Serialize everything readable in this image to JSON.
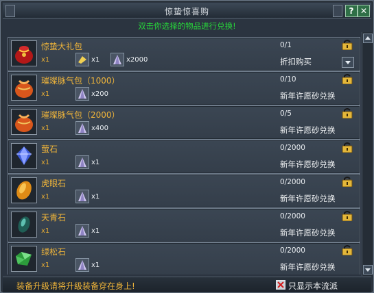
{
  "window": {
    "title": "惊蛰惊喜购",
    "help_label": "?",
    "close_label": "✕"
  },
  "instruction": "双击你选择的物品进行兑换!",
  "items": [
    {
      "name": "惊蛰大礼包",
      "qty": "x1",
      "costs": [
        {
          "icon": "gold-coin-icon",
          "amount": "x1"
        },
        {
          "icon": "crystal-sand-icon",
          "amount": "x2000"
        }
      ],
      "progress": "0/1",
      "exchange": "折扣购买",
      "icon": "red-gift-bag"
    },
    {
      "name": "璀璨脉气包（1000）",
      "qty": "x1",
      "costs": [
        {
          "icon": "crystal-sand-icon",
          "amount": "x200"
        }
      ],
      "progress": "0/10",
      "exchange": "新年许愿砂兑换",
      "icon": "orange-bag"
    },
    {
      "name": "璀璨脉气包（2000）",
      "qty": "x1",
      "costs": [
        {
          "icon": "crystal-sand-icon",
          "amount": "x400"
        }
      ],
      "progress": "0/5",
      "exchange": "新年许愿砂兑换",
      "icon": "orange-bag"
    },
    {
      "name": "萤石",
      "qty": "x1",
      "costs": [
        {
          "icon": "crystal-sand-icon",
          "amount": "x1"
        }
      ],
      "progress": "0/2000",
      "exchange": "新年许愿砂兑换",
      "icon": "blue-gem"
    },
    {
      "name": "虎眼石",
      "qty": "x1",
      "costs": [
        {
          "icon": "crystal-sand-icon",
          "amount": "x1"
        }
      ],
      "progress": "0/2000",
      "exchange": "新年许愿砂兑换",
      "icon": "amber-gem"
    },
    {
      "name": "天青石",
      "qty": "x1",
      "costs": [
        {
          "icon": "crystal-sand-icon",
          "amount": "x1"
        }
      ],
      "progress": "0/2000",
      "exchange": "新年许愿砂兑换",
      "icon": "teal-gem"
    },
    {
      "name": "绿松石",
      "qty": "x1",
      "costs": [
        {
          "icon": "crystal-sand-icon",
          "amount": "x1"
        }
      ],
      "progress": "0/2000",
      "exchange": "新年许愿砂兑换",
      "icon": "green-gem"
    }
  ],
  "footer": {
    "tip": "装备升级请将升级装备穿在身上!",
    "filter_label": "只显示本流派",
    "filter_checked": true
  }
}
